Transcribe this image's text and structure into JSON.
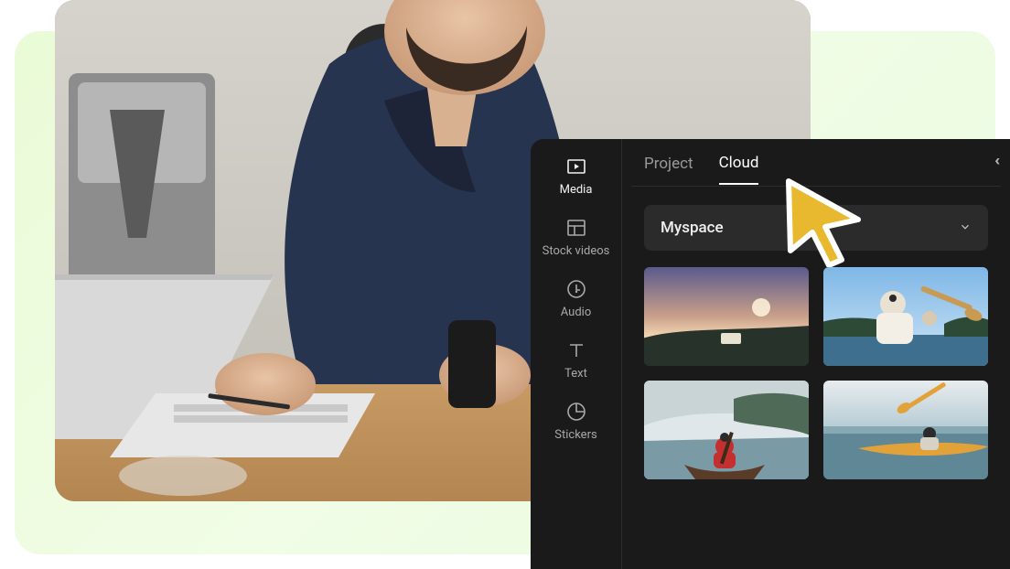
{
  "sidebar": {
    "items": [
      {
        "label": "Media",
        "name": "sidebar-item-media",
        "icon": "media-icon",
        "active": true
      },
      {
        "label": "Stock videos",
        "name": "sidebar-item-stock-videos",
        "icon": "stock-icon",
        "active": false
      },
      {
        "label": "Audio",
        "name": "sidebar-item-audio",
        "icon": "audio-icon",
        "active": false
      },
      {
        "label": "Text",
        "name": "sidebar-item-text",
        "icon": "text-icon",
        "active": false
      },
      {
        "label": "Stickers",
        "name": "sidebar-item-stickers",
        "icon": "sticker-icon",
        "active": false
      }
    ]
  },
  "tabs": {
    "project": "Project",
    "cloud": "Cloud",
    "active": "cloud"
  },
  "dropdown": {
    "selected": "Myspace"
  },
  "thumbnails": [
    {
      "name": "thumb-sunset-van"
    },
    {
      "name": "thumb-boat-paddle"
    },
    {
      "name": "thumb-red-canoe"
    },
    {
      "name": "thumb-kayak-sea"
    }
  ]
}
